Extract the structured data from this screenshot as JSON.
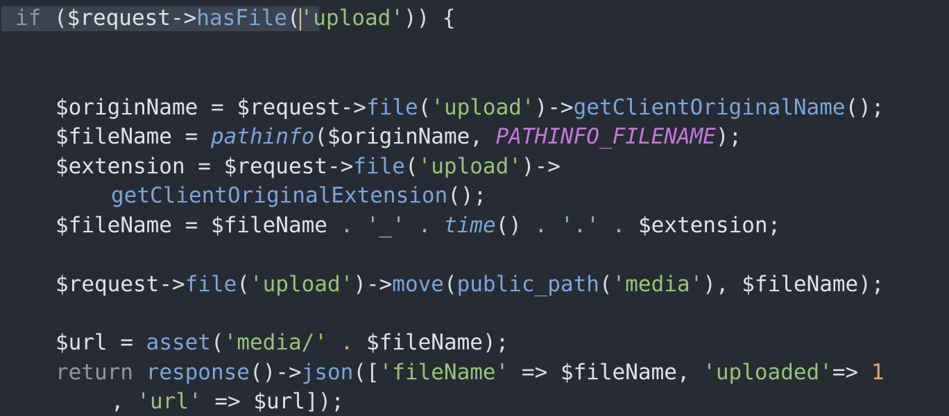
{
  "editor": {
    "line1": {
      "kw_if": "if",
      "p1": " (",
      "var": "$request",
      "arrow": "->",
      "fn": "hasFile",
      "paren": "(",
      "str": "'upload'",
      "end": ")) {"
    },
    "line2": {
      "var1": "$originName",
      "eq": " = ",
      "var2": "$request",
      "arrow1": "->",
      "fn1": "file",
      "p1": "(",
      "str": "'upload'",
      "p2": ")",
      "arrow2": "->",
      "fn2": "getClientOriginalName",
      "end": "();"
    },
    "line3": {
      "var1": "$fileName",
      "eq": " = ",
      "fn": "pathinfo",
      "p1": "(",
      "var2": "$originName",
      "comma": ", ",
      "const": "PATHINFO_FILENAME",
      "end": ");"
    },
    "line4": {
      "var1": "$extension",
      "eq": " = ",
      "var2": "$request",
      "arrow1": "->",
      "fn": "file",
      "p1": "(",
      "str": "'upload'",
      "p2": ")",
      "arrow2": "->"
    },
    "line5": {
      "fn": "getClientOriginalExtension",
      "end": "();"
    },
    "line6": {
      "var1": "$fileName",
      "eq": " = ",
      "var2": "$fileName",
      "dot1": " . ",
      "str1": "'_'",
      "dot2": " . ",
      "fn": "time",
      "p": "()",
      "dot3": " . ",
      "str2": "'.'",
      "dot4": " . ",
      "var3": "$extension",
      "end": ";"
    },
    "line7": {
      "var1": "$request",
      "arrow1": "->",
      "fn1": "file",
      "p1": "(",
      "str1": "'upload'",
      "p2": ")",
      "arrow2": "->",
      "fn2": "move",
      "p3": "(",
      "fn3": "public_path",
      "p4": "(",
      "str2": "'media'",
      "p5": "), ",
      "var2": "$fileName",
      "end": ");"
    },
    "line8": {
      "var1": "$url",
      "eq": " = ",
      "fn": "asset",
      "p1": "(",
      "str": "'media/'",
      "dot": " . ",
      "var2": "$fileName",
      "end": ");"
    },
    "line9": {
      "kw": "return",
      "sp": " ",
      "fn1": "response",
      "p1": "()",
      "arrow": "->",
      "fn2": "json",
      "p2": "([",
      "str1": "'fileName'",
      "op1": " => ",
      "var1": "$fileName",
      "comma": ", ",
      "str2": "'uploaded'",
      "op2": "=> ",
      "num": "1"
    },
    "line10": {
      "comma": ", ",
      "str": "'url'",
      "op": " => ",
      "var": "$url",
      "end": "]);"
    }
  }
}
